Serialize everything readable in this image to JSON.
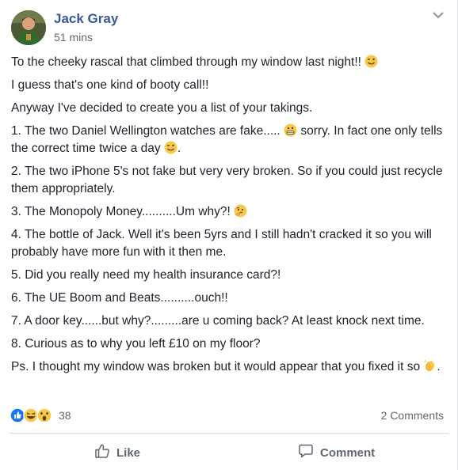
{
  "post": {
    "author": "Jack Gray",
    "time": "51 mins",
    "lines": [
      "To the cheeky rascal that climbed through my window last night!!",
      "I guess that's one kind of booty call!!",
      "Anyway I've decided to create you a list of your takings.",
      "1. The two Daniel Wellington watches are fake.....",
      "sorry. In fact one only tells the correct time twice a day",
      ".",
      "2. The two iPhone 5's not fake but very very broken. So if you could just recycle them appropriately.",
      "3. The Monopoly Money..........Um why?!",
      "4. The bottle of Jack. Well it's been 5yrs and I still hadn't cracked it so you will probably have more fun with it then me.",
      "5. Did you really need my health insurance card?!",
      "6. The UE Boom and Beats..........ouch!!",
      "7. A door key......but why?.........are u coming back? At least knock next time.",
      "8. Curious as to why you left £10 on my floor?",
      "Ps. I thought my window was broken but it would appear that you fixed it so",
      "."
    ],
    "emojis": {
      "wink": "winking-face-tongue",
      "grimace": "grimacing-face",
      "tongue": "winking-face-tongue",
      "thinking": "thinking-face",
      "clap": "clapping-hands"
    }
  },
  "reactions": {
    "icons": [
      "like",
      "haha",
      "wow"
    ],
    "count": "38",
    "comments": "2 Comments"
  },
  "actions": {
    "like": "Like",
    "comment": "Comment"
  },
  "colors": {
    "author": "#365899",
    "like_blue": "#1877f2",
    "emoji_yellow": "#f7c948"
  }
}
